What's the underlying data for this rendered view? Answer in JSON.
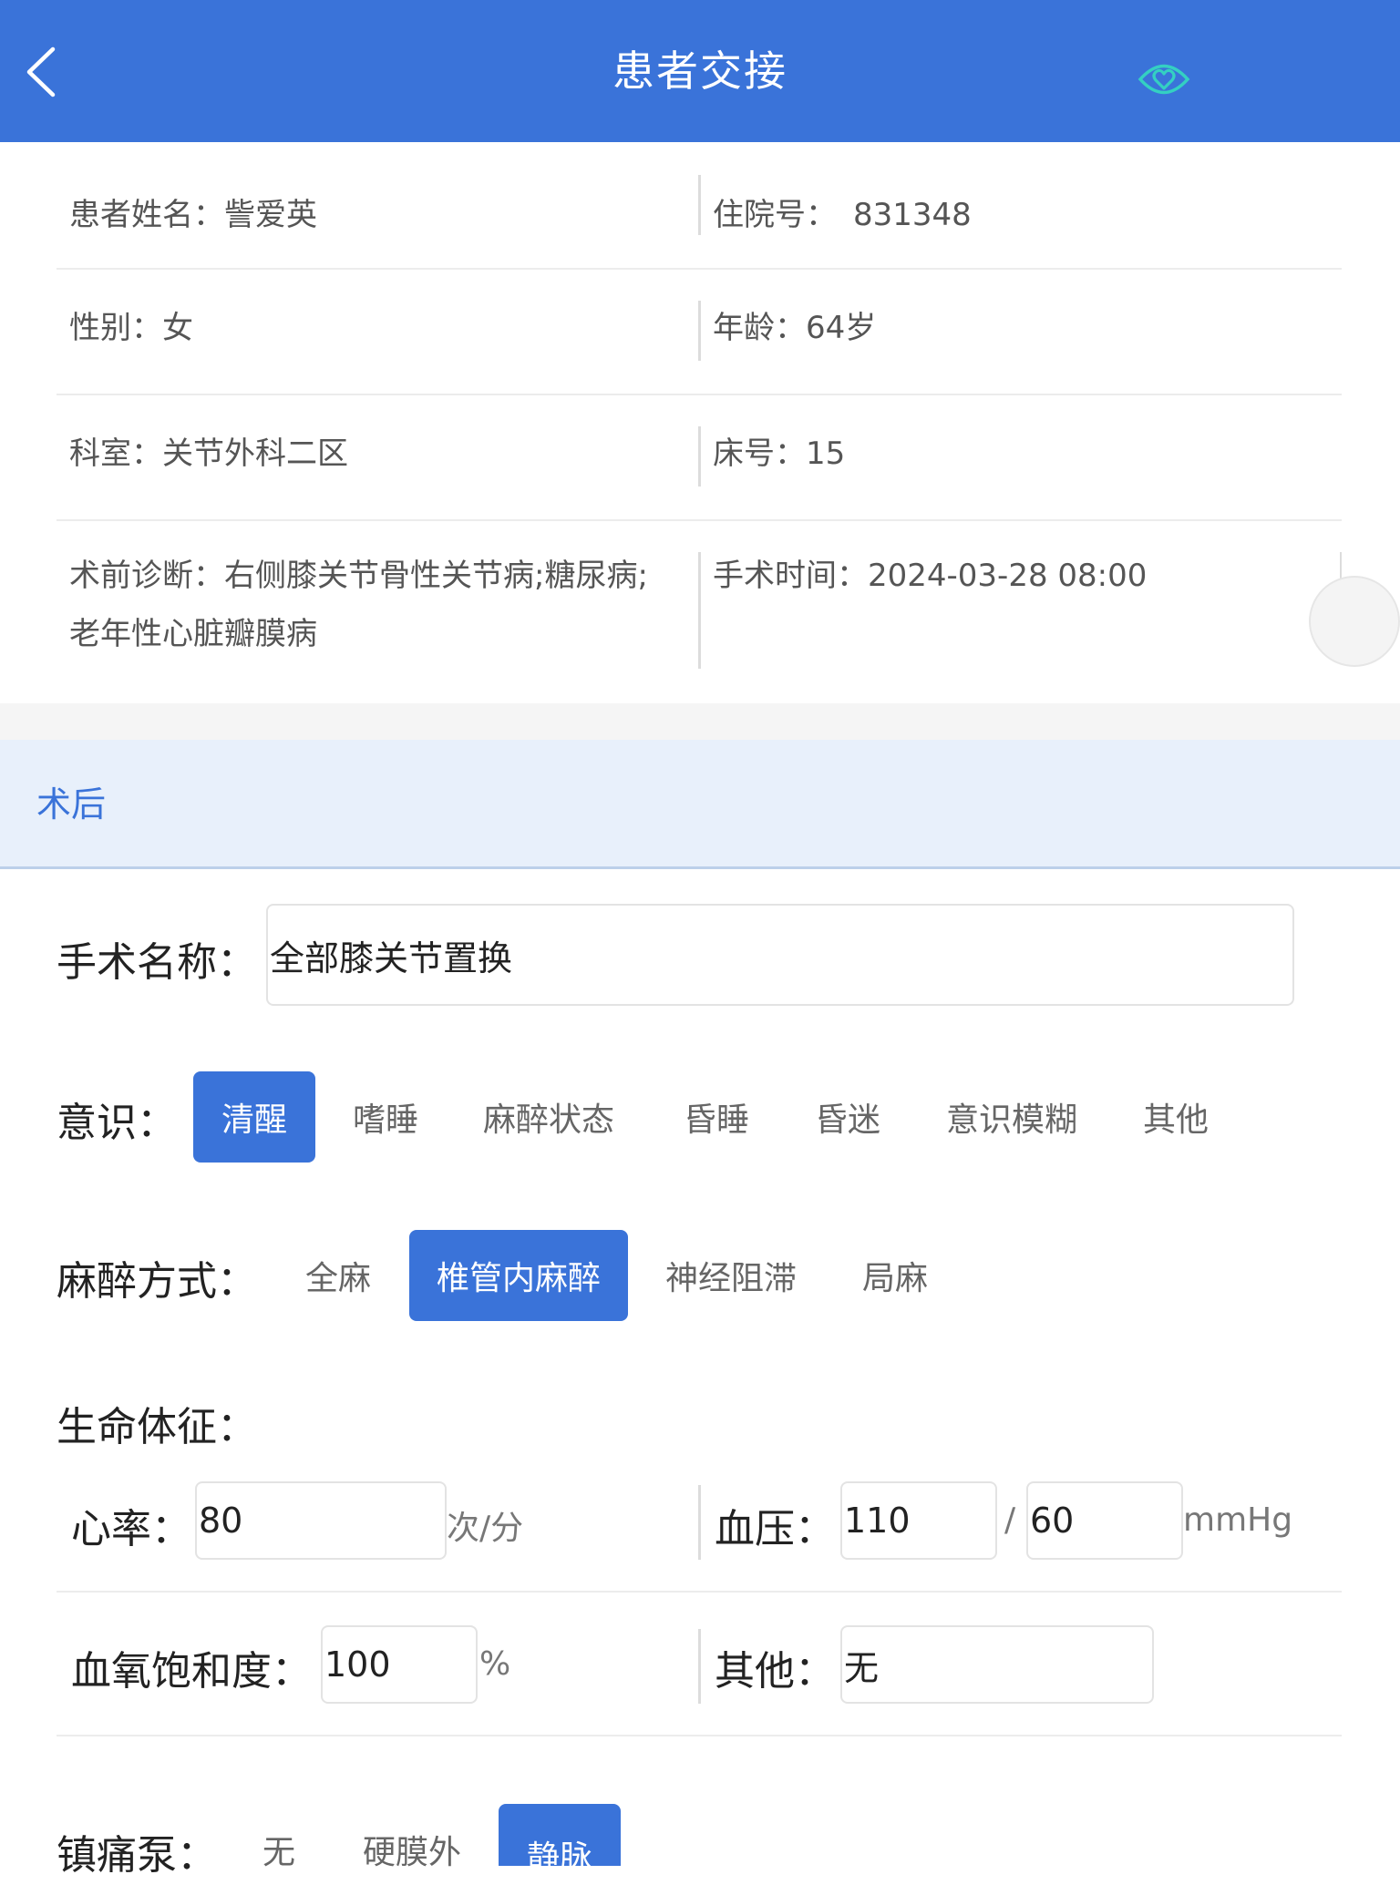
{
  "header": {
    "title": "患者交接",
    "back_icon": "chevron-left-icon",
    "action_icon": "heart-eye-icon"
  },
  "patient": {
    "name_label": "患者姓名：",
    "name": "訾爱英",
    "admission_label": "住院号：",
    "admission_no": "831348",
    "gender_label": "性别：",
    "gender": "女",
    "age_label": "年龄：",
    "age": "64岁",
    "department_label": "科室：",
    "department": "关节外科二区",
    "bed_label": "床号：",
    "bed": "15",
    "diagnosis_label": "术前诊断：",
    "diagnosis_line1": "右侧膝关节骨性关节病;糖尿病;",
    "diagnosis_line2": "老年性心脏瓣膜病",
    "surgery_time_label": "手术时间：",
    "surgery_time": "2024-03-28 08:00"
  },
  "section": {
    "title": "术后"
  },
  "form": {
    "surgery_name_label": "手术名称：",
    "surgery_name": "全部膝关节置换",
    "consciousness_label": "意识：",
    "consciousness_options": [
      "清醒",
      "嗜睡",
      "麻醉状态",
      "昏睡",
      "昏迷",
      "意识模糊",
      "其他"
    ],
    "consciousness_selected": "清醒",
    "anesthesia_label": "麻醉方式：",
    "anesthesia_options": [
      "全麻",
      "椎管内麻醉",
      "神经阻滞",
      "局麻"
    ],
    "anesthesia_selected": "椎管内麻醉",
    "vitals_label": "生命体征：",
    "heart_rate_label": "心率：",
    "heart_rate": "80",
    "heart_rate_unit": "次/分",
    "bp_label": "血压：",
    "bp_systolic": "110",
    "bp_sep": "/",
    "bp_diastolic": "60",
    "bp_unit": "mmHg",
    "spo2_label": "血氧饱和度：",
    "spo2": "100",
    "spo2_unit": "%",
    "other_label": "其他：",
    "other": "无",
    "pump_label": "镇痛泵：",
    "pump_options": [
      "无",
      "硬膜外",
      "静脉"
    ],
    "pump_selected": "静脉"
  },
  "colors": {
    "primary": "#3a73d9",
    "section_bg": "#e8f0fb",
    "heart_icon": "#34d0c2"
  }
}
